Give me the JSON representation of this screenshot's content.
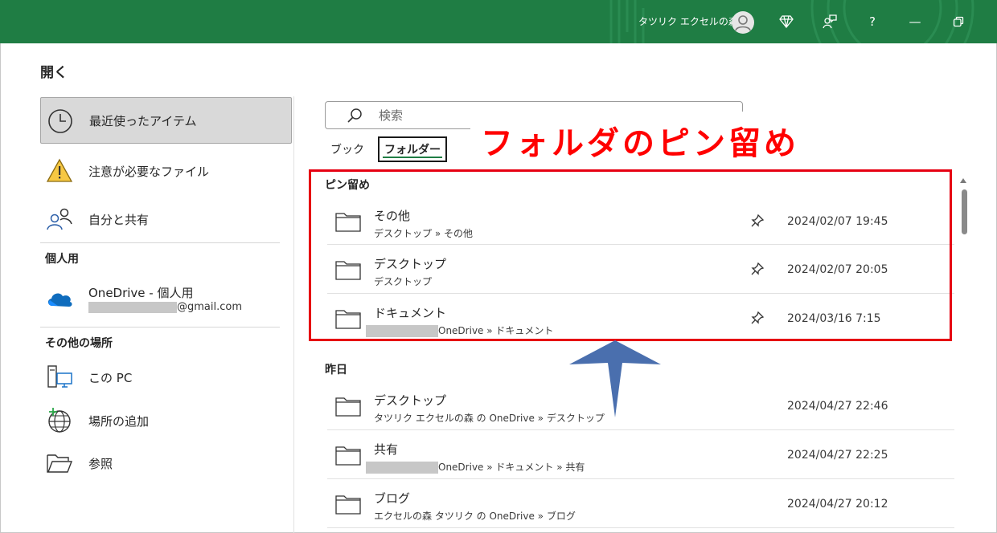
{
  "titlebar": {
    "user_name": "タツリク エクセルの森",
    "help_label": "?",
    "minimize_label": "—",
    "colors": {
      "background": "#1f7d44"
    }
  },
  "page": {
    "title": "開く"
  },
  "nav": {
    "recent": "最近使ったアイテム",
    "attention": "注意が必要なファイル",
    "shared": "自分と共有",
    "personal_section": "個人用",
    "onedrive_name": "OneDrive - 個人用",
    "onedrive_email_suffix": "@gmail.com",
    "other_section": "その他の場所",
    "this_pc": "この PC",
    "add_place": "場所の追加",
    "browse": "参照"
  },
  "search": {
    "placeholder": "検索"
  },
  "tabs": {
    "book": "ブック",
    "folder": "フォルダー"
  },
  "annotation": {
    "text": "フォルダのピン留め",
    "colors": {
      "text": "#ff0000",
      "box": "#e60012",
      "arrow": "#4a6fae"
    }
  },
  "pinned": {
    "heading": "ピン留め",
    "rows": [
      {
        "name": "その他",
        "path": "デスクトップ » その他",
        "date": "2024/02/07 19:45"
      },
      {
        "name": "デスクトップ",
        "path": "デスクトップ",
        "date": "2024/02/07 20:05"
      },
      {
        "name": "ドキュメント",
        "path": "OneDrive » ドキュメント",
        "date": "2024/03/16 7:15"
      }
    ]
  },
  "yesterday": {
    "heading": "昨日",
    "rows": [
      {
        "name": "デスクトップ",
        "path": "タツリク エクセルの森 の OneDrive » デスクトップ",
        "date": "2024/04/27 22:46"
      },
      {
        "name": "共有",
        "path": "OneDrive » ドキュメント » 共有",
        "date": "2024/04/27 22:25"
      },
      {
        "name": "ブログ",
        "path": "エクセルの森 タツリク の OneDrive » ブログ",
        "date": "2024/04/27 20:12"
      }
    ]
  }
}
